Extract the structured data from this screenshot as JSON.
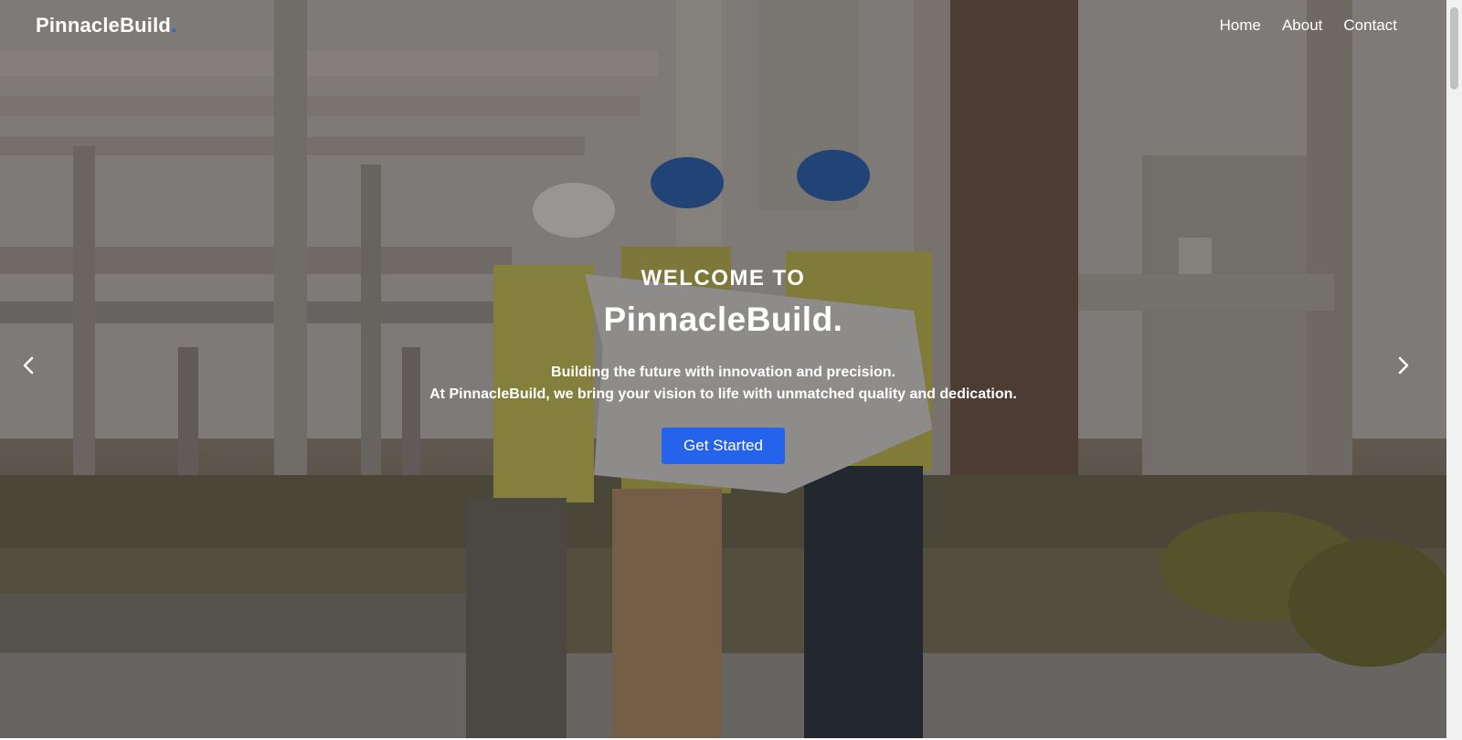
{
  "navbar": {
    "logo_text": "PinnacleBuild",
    "logo_dot": ".",
    "links": [
      "Home",
      "About",
      "Contact"
    ]
  },
  "hero": {
    "welcome": "WELCOME TO",
    "brand": "PinnacleBuild.",
    "tagline_line1": "Building the future with innovation and precision.",
    "tagline_line2": "At PinnacleBuild, we bring your vision to life with unmatched quality and dedication.",
    "cta_label": "Get Started"
  },
  "carousel": {
    "prev_icon": "chevron-left-icon",
    "next_icon": "chevron-right-icon"
  },
  "colors": {
    "accent": "#2563eb",
    "text": "#ffffff"
  }
}
